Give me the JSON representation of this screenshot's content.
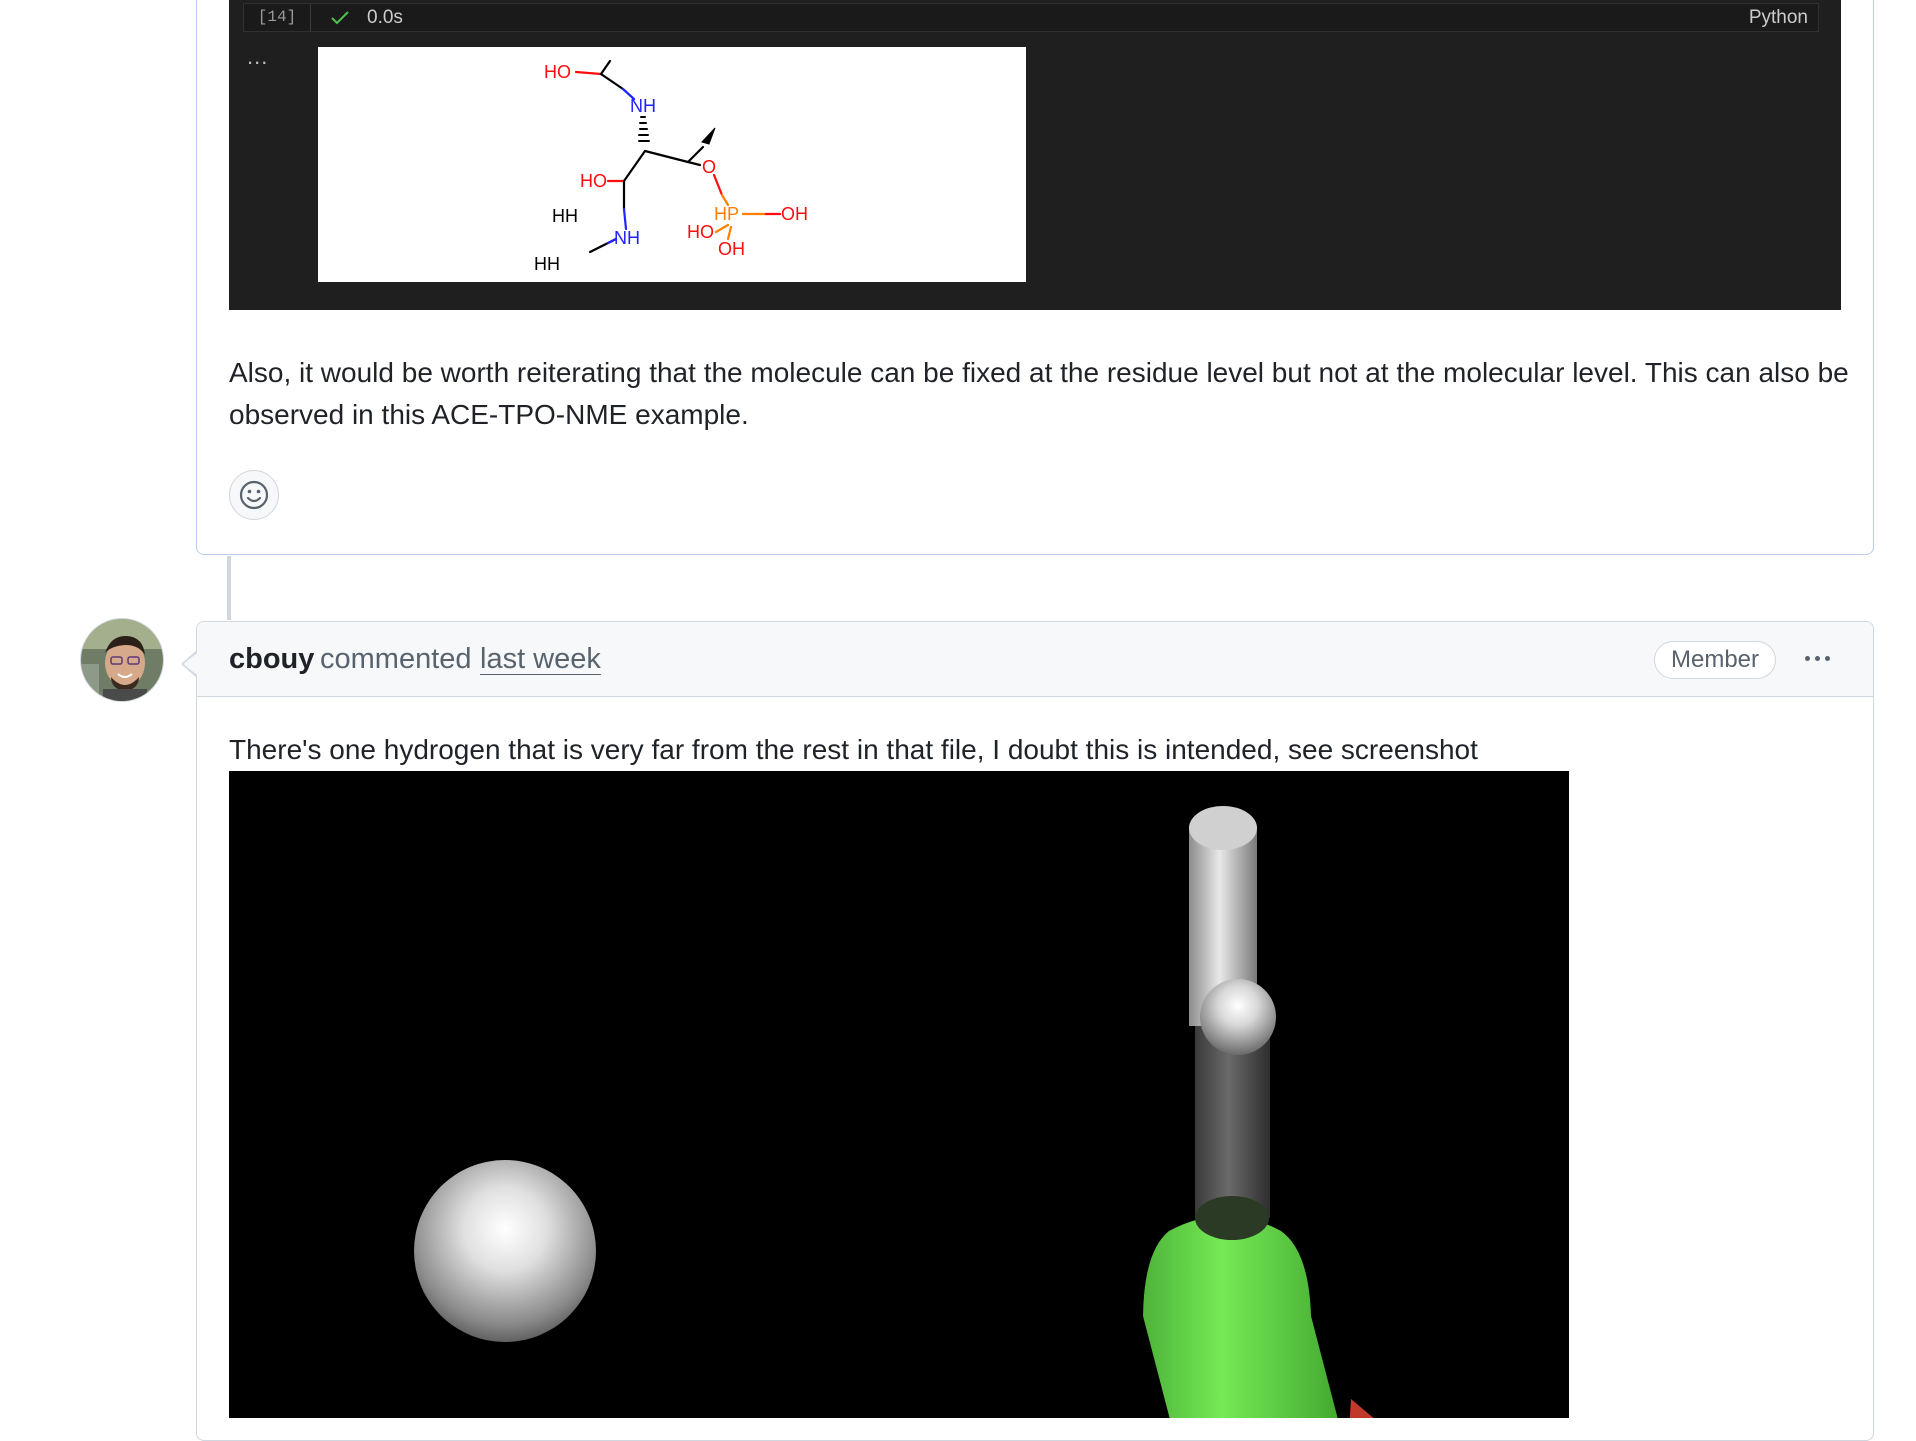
{
  "notebook_cell": {
    "execution_count": "[14]",
    "duration": "0.0s",
    "language": "Python",
    "output_marker": "...",
    "molecule_labels": {
      "ho_top": "HO",
      "nh_top": "NH",
      "ho_mid": "HO",
      "o_ester": "O",
      "hh_upper": "HH",
      "hh_lower": "HH",
      "nh_bottom": "NH",
      "hp": "HP",
      "oh_right": "OH",
      "ho_phos": "HO",
      "oh_bottom": "OH"
    }
  },
  "first_comment": {
    "body": "Also, it would be worth reiterating that the molecule can be fixed at the residue level but not at the molecular level. This can also be observed in this ACE-TPO-NME example."
  },
  "second_comment": {
    "author": "cbouy",
    "action": "commented",
    "timestamp": "last week",
    "badge": "Member",
    "body": "There's one hydrogen that is very far from the rest in that file, I doubt this is intended, see screenshot"
  },
  "icons": {
    "check": "check-icon",
    "reaction": "smiley-icon",
    "menu": "kebab-horizontal-icon"
  },
  "colors": {
    "notebook_bg": "#1f1f1f",
    "oxygen": "#ff0d0d",
    "nitrogen": "#2222ff",
    "phosphorus": "#ff8000",
    "carbon_bond": "#000000",
    "card_border_highlight": "#b6cdf0",
    "bond_green": "#6de650"
  }
}
